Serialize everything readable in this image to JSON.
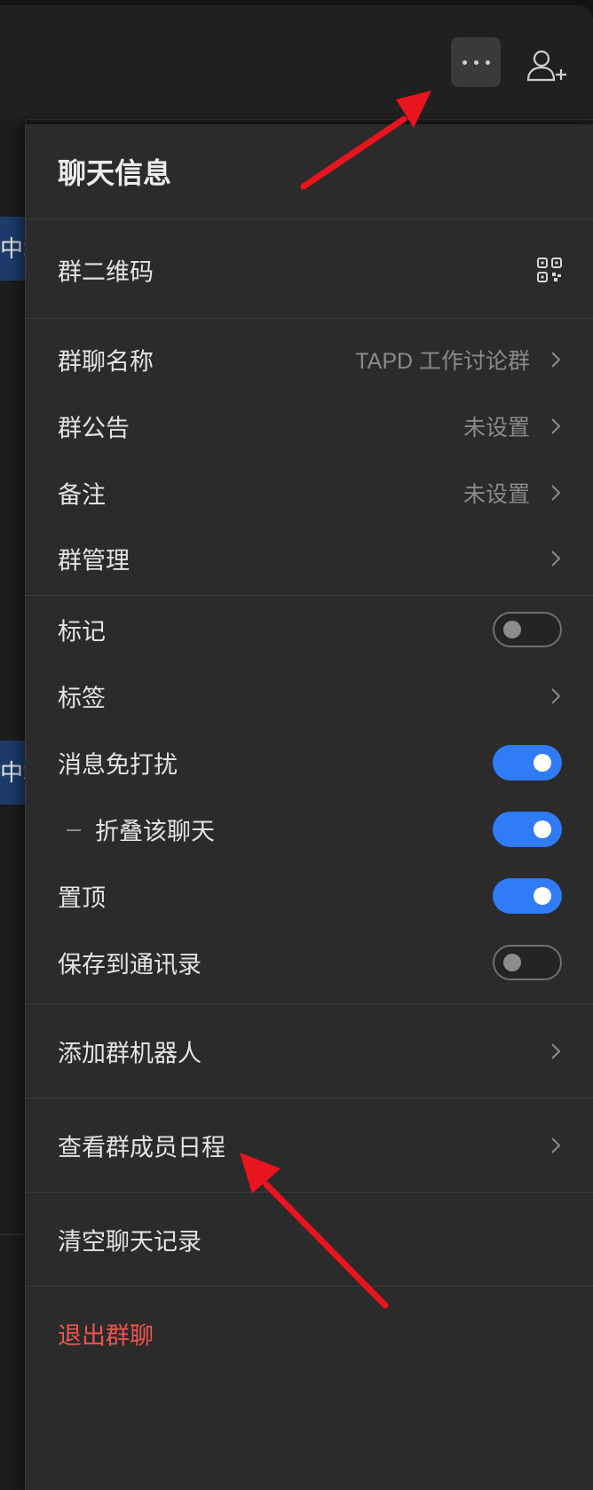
{
  "header": {
    "more_icon": "more-dots-icon",
    "add_member_icon": "add-user-icon"
  },
  "background": {
    "badge_top_text": "中术",
    "badge_bottom_text": "中术"
  },
  "panel": {
    "title": "聊天信息",
    "qr_row": {
      "label": "群二维码",
      "icon": "qr-code-icon"
    },
    "group_name": {
      "label": "群聊名称",
      "value": "TAPD 工作讨论群"
    },
    "announcement": {
      "label": "群公告",
      "value": "未设置"
    },
    "remark": {
      "label": "备注",
      "value": "未设置"
    },
    "manage": {
      "label": "群管理"
    },
    "mark": {
      "label": "标记",
      "toggle": false
    },
    "tags": {
      "label": "标签"
    },
    "mute": {
      "label": "消息免打扰",
      "toggle": true
    },
    "fold": {
      "label": "折叠该聊天",
      "toggle": true
    },
    "pin": {
      "label": "置顶",
      "toggle": true
    },
    "save_contacts": {
      "label": "保存到通讯录",
      "toggle": false
    },
    "add_bot": {
      "label": "添加群机器人"
    },
    "member_schedule": {
      "label": "查看群成员日程"
    },
    "clear_history": {
      "label": "清空聊天记录"
    },
    "exit_group": {
      "label": "退出群聊"
    }
  },
  "colors": {
    "accent_toggle": "#2f7cf6",
    "danger": "#f0544f",
    "annotation_arrow": "#e8141e"
  }
}
